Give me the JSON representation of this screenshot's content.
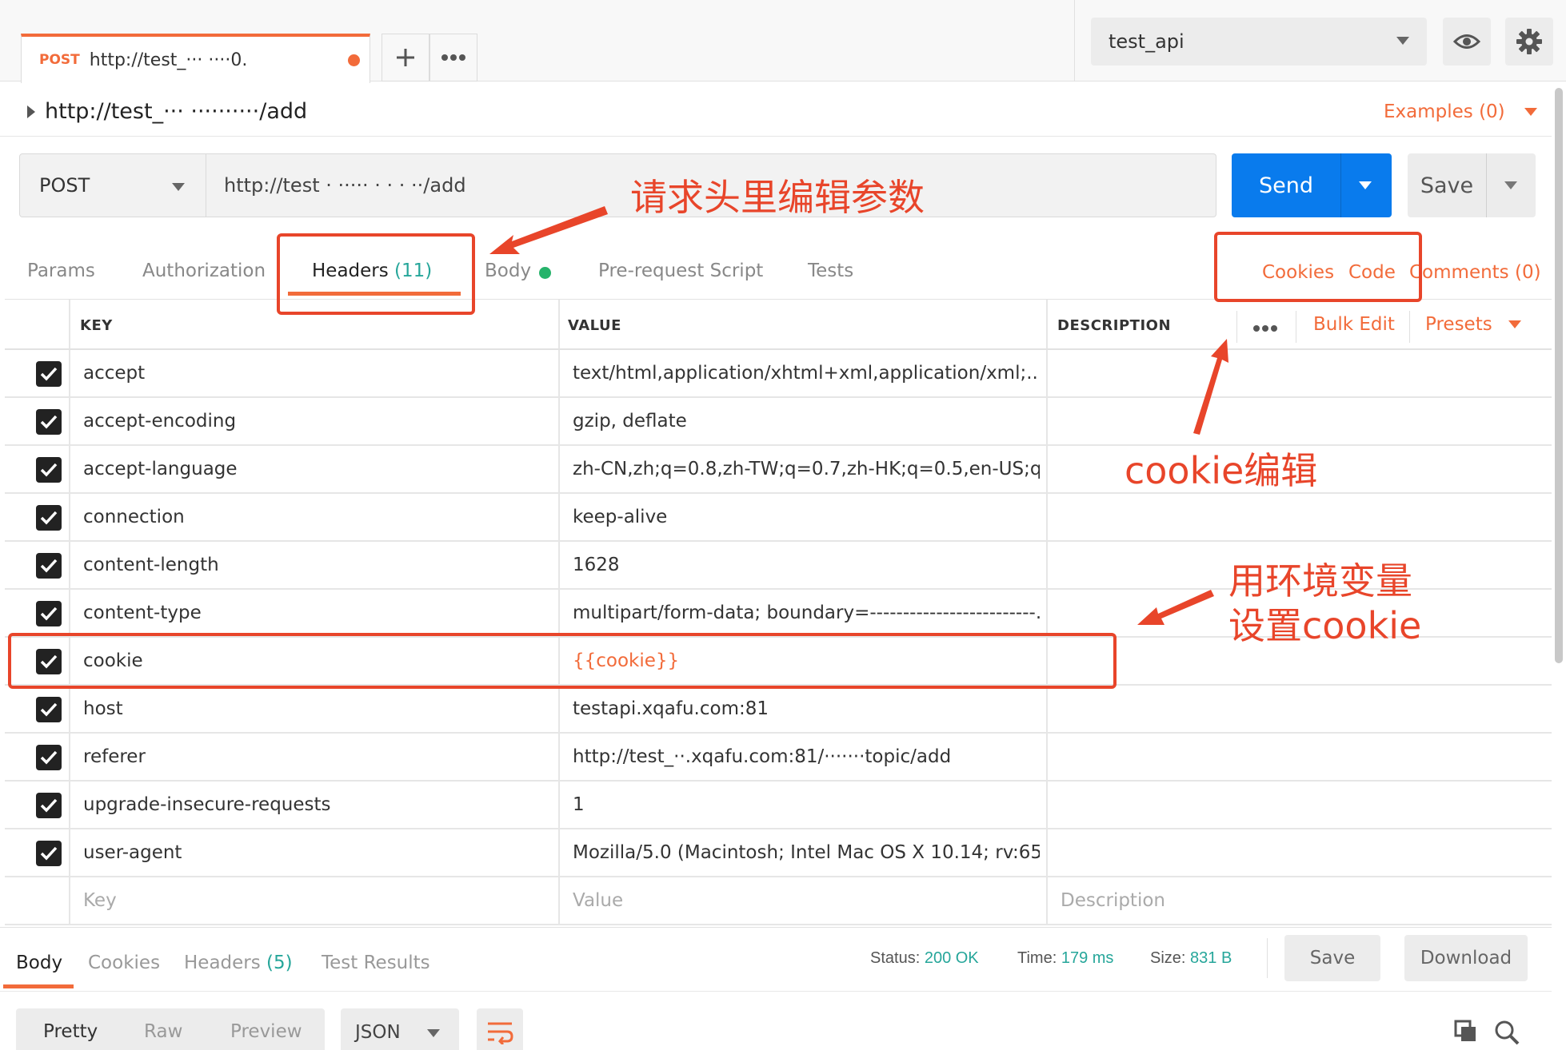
{
  "tab": {
    "method": "POST",
    "url": "http://test_··· ····0.",
    "new_tab_icon": "plus-icon",
    "more_icon": "more-horizontal-icon"
  },
  "environment": {
    "selected": "test_api",
    "eye_icon": "eye-icon",
    "settings_icon": "gear-icon"
  },
  "breadcrumb": {
    "title": "http://test_··· ··········/add",
    "examples": "Examples (0)"
  },
  "request": {
    "method": "POST",
    "url": "http://test  · ····· · · ·  ··/add",
    "send_label": "Send",
    "save_label": "Save"
  },
  "request_tabs": {
    "params": "Params",
    "authorization": "Authorization",
    "headers": "Headers",
    "headers_count": "(11)",
    "body": "Body",
    "pre_request": "Pre-request Script",
    "tests": "Tests",
    "cookies": "Cookies",
    "code": "Code",
    "comments": "Comments (0)"
  },
  "headers_table": {
    "columns": {
      "key": "KEY",
      "value": "VALUE",
      "description": "DESCRIPTION"
    },
    "bulk_edit": "Bulk Edit",
    "presets": "Presets",
    "rows": [
      {
        "key": "accept",
        "value": "text/html,application/xhtml+xml,application/xml;..."
      },
      {
        "key": "accept-encoding",
        "value": "gzip, deflate"
      },
      {
        "key": "accept-language",
        "value": "zh-CN,zh;q=0.8,zh-TW;q=0.7,zh-HK;q=0.5,en-US;q=..."
      },
      {
        "key": "connection",
        "value": "keep-alive"
      },
      {
        "key": "content-length",
        "value": "1628"
      },
      {
        "key": "content-type",
        "value": "multipart/form-data; boundary=-------------------------..."
      },
      {
        "key": "cookie",
        "value": "{{cookie}}"
      },
      {
        "key": "host",
        "value": "testapi.xqafu.com:81"
      },
      {
        "key": "referer",
        "value": "http://test_··.xqafu.com:81/·······topic/add"
      },
      {
        "key": "upgrade-insecure-requests",
        "value": "1"
      },
      {
        "key": "user-agent",
        "value": "Mozilla/5.0 (Macintosh; Intel Mac OS X 10.14; rv:65..."
      }
    ],
    "new_row": {
      "key": "Key",
      "value": "Value",
      "description": "Description"
    }
  },
  "response": {
    "tabs": {
      "body": "Body",
      "cookies": "Cookies",
      "headers": "Headers",
      "headers_count": "(5)",
      "test_results": "Test Results"
    },
    "status_label": "Status:",
    "status_value": "200 OK",
    "time_label": "Time:",
    "time_value": "179 ms",
    "size_label": "Size:",
    "size_value": "831 B",
    "save_label": "Save",
    "download_label": "Download",
    "formats": {
      "pretty": "Pretty",
      "raw": "Raw",
      "preview": "Preview"
    },
    "language": "JSON"
  },
  "annotations": {
    "headers_note": "请求头里编辑参数",
    "cookie_note": "cookie编辑",
    "env_note_line1": "用环境变量",
    "env_note_line2": "设置cookie"
  },
  "colors": {
    "accent": "#f26b3a",
    "send": "#097bed",
    "count": "#26a69a",
    "annotation": "#e8452a"
  }
}
